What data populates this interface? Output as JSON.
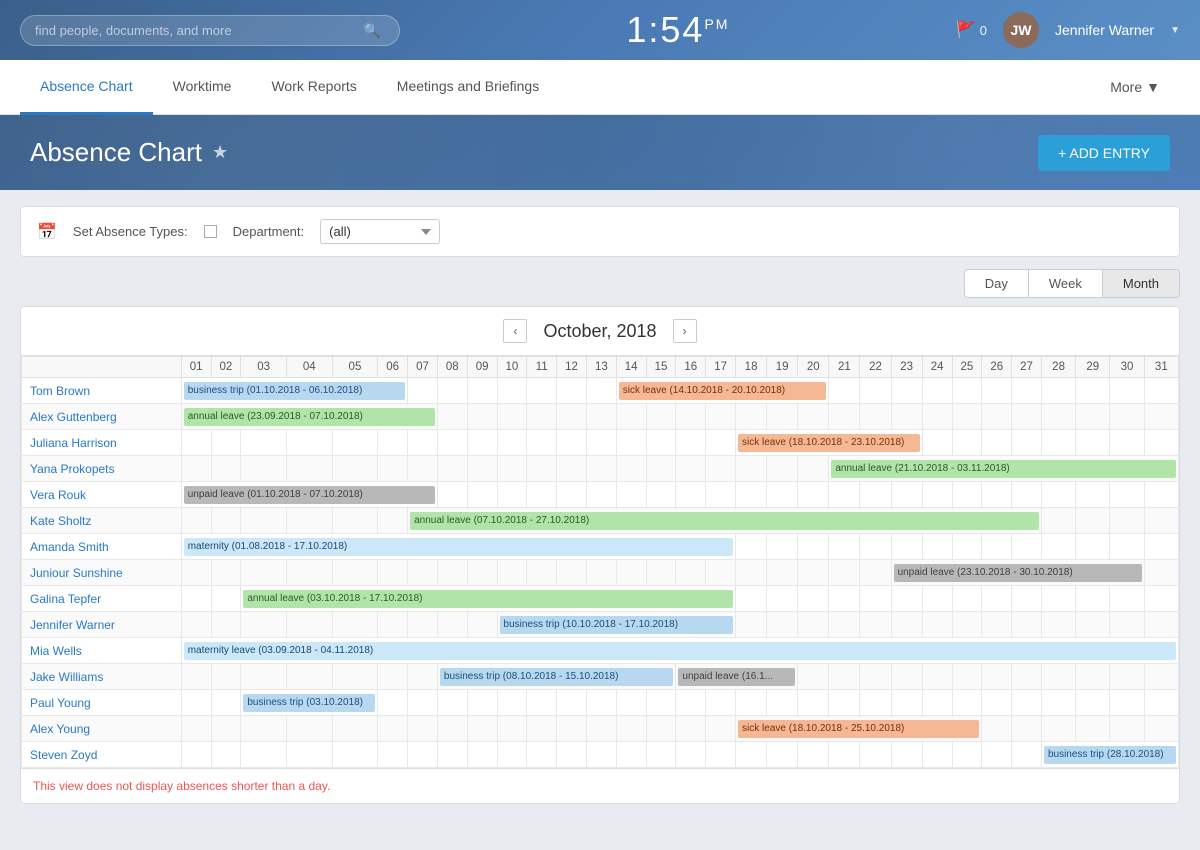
{
  "topbar": {
    "search_placeholder": "find people, documents, and more",
    "time": "1:54",
    "ampm": "PM",
    "flag_count": "0",
    "user_name": "Jennifer Warner",
    "user_initials": "JW"
  },
  "navbar": {
    "items": [
      {
        "label": "Absence Chart",
        "active": true
      },
      {
        "label": "Worktime",
        "active": false
      },
      {
        "label": "Work Reports",
        "active": false
      },
      {
        "label": "Meetings and Briefings",
        "active": false
      }
    ],
    "more_label": "More"
  },
  "page": {
    "title": "Absence Chart",
    "add_button": "+ ADD ENTRY"
  },
  "filter": {
    "absence_types_label": "Set Absence Types:",
    "department_label": "Department:",
    "department_value": "(all)"
  },
  "view_controls": {
    "day_label": "Day",
    "week_label": "Week",
    "month_label": "Month"
  },
  "calendar": {
    "month_title": "October, 2018",
    "days": [
      "01",
      "02",
      "03",
      "04",
      "05",
      "06",
      "07",
      "08",
      "09",
      "10",
      "11",
      "12",
      "13",
      "14",
      "15",
      "16",
      "17",
      "18",
      "19",
      "20",
      "21",
      "22",
      "23",
      "24",
      "25",
      "26",
      "27",
      "28",
      "29",
      "30",
      "31"
    ],
    "employees": [
      {
        "name": "Tom Brown",
        "events": [
          {
            "label": "business trip (01.10.2018 - 06.10.2018)",
            "start": 1,
            "end": 6,
            "type": "business"
          },
          {
            "label": "sick leave (14.10.2018 - 20.10.2018)",
            "start": 14,
            "end": 20,
            "type": "sick"
          }
        ]
      },
      {
        "name": "Alex Guttenberg",
        "events": [
          {
            "label": "annual leave (23.09.2018 - 07.10.2018)",
            "start": 1,
            "end": 7,
            "type": "annual"
          }
        ]
      },
      {
        "name": "Juliana Harrison",
        "events": [
          {
            "label": "sick leave (18.10.2018 - 23.10.2018)",
            "start": 18,
            "end": 23,
            "type": "sick"
          }
        ]
      },
      {
        "name": "Yana Prokopets",
        "events": [
          {
            "label": "annual leave (21.10.2018 - 03.11.2018)",
            "start": 21,
            "end": 31,
            "type": "annual"
          }
        ]
      },
      {
        "name": "Vera Rouk",
        "events": [
          {
            "label": "unpaid leave (01.10.2018 - 07.10.2018)",
            "start": 1,
            "end": 7,
            "type": "unpaid"
          }
        ]
      },
      {
        "name": "Kate Sholtz",
        "events": [
          {
            "label": "annual leave (07.10.2018 - 27.10.2018)",
            "start": 7,
            "end": 27,
            "type": "annual"
          }
        ]
      },
      {
        "name": "Amanda Smith",
        "events": [
          {
            "label": "maternity (01.08.2018 - 17.10.2018)",
            "start": 1,
            "end": 17,
            "type": "maternity"
          }
        ]
      },
      {
        "name": "Juniour Sunshine",
        "events": [
          {
            "label": "unpaid leave (23.10.2018 - 30.10.2018)",
            "start": 23,
            "end": 30,
            "type": "unpaid"
          }
        ]
      },
      {
        "name": "Galina Tepfer",
        "events": [
          {
            "label": "annual leave (03.10.2018 - 17.10.2018)",
            "start": 3,
            "end": 17,
            "type": "annual"
          }
        ]
      },
      {
        "name": "Jennifer Warner",
        "events": [
          {
            "label": "business trip (10.10.2018 - 17.10.2018)",
            "start": 10,
            "end": 17,
            "type": "business"
          }
        ]
      },
      {
        "name": "Mia Wells",
        "events": [
          {
            "label": "maternity leave (03.09.2018 - 04.11.2018)",
            "start": 1,
            "end": 31,
            "type": "maternity"
          }
        ]
      },
      {
        "name": "Jake Williams",
        "events": [
          {
            "label": "business trip (08.10.2018 - 15.10.2018)",
            "start": 8,
            "end": 15,
            "type": "business"
          },
          {
            "label": "unpaid leave (16.1...",
            "start": 16,
            "end": 19,
            "type": "unpaid"
          }
        ]
      },
      {
        "name": "Paul Young",
        "events": [
          {
            "label": "business trip (03.10.2018)",
            "start": 3,
            "end": 5,
            "type": "business"
          }
        ]
      },
      {
        "name": "Alex Young",
        "events": [
          {
            "label": "sick leave (18.10.2018 - 25.10.2018)",
            "start": 18,
            "end": 25,
            "type": "sick"
          }
        ]
      },
      {
        "name": "Steven Zoyd",
        "events": [
          {
            "label": "business trip (28.10.2018)",
            "start": 28,
            "end": 31,
            "type": "business"
          }
        ]
      }
    ]
  },
  "footer": {
    "note": "This view does not display absences shorter than a day."
  }
}
